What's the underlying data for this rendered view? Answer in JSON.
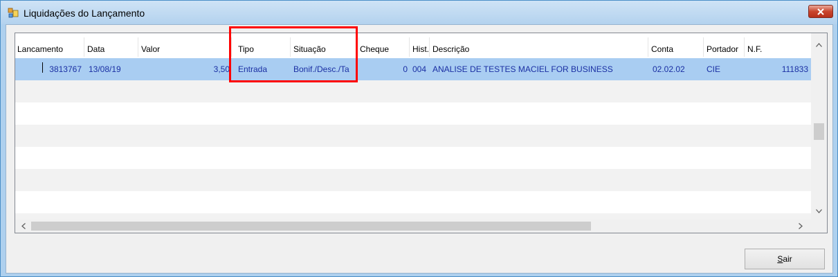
{
  "window": {
    "title": "Liquidações do Lançamento"
  },
  "grid": {
    "columns": [
      "Lancamento",
      "Data",
      "Valor",
      "Tipo",
      "Situação",
      "Cheque",
      "Hist.",
      "Descrição",
      "Conta",
      "Portador",
      "N.F."
    ],
    "rows": [
      {
        "lancamento": "3813767",
        "data": "13/08/19",
        "valor": "3,50",
        "tipo": "Entrada",
        "situacao": "Bonif./Desc./Ta",
        "cheque": "0",
        "hist": "004",
        "descricao": "ANALISE DE TESTES MACIEL FOR BUSINESS",
        "conta": "02.02.02",
        "portador": "CIE",
        "nf": "111833"
      }
    ]
  },
  "buttons": {
    "sair_mnemonic": "S",
    "sair_rest": "air"
  },
  "colors": {
    "selection": "#a9cdf2",
    "cell_text": "#1a2fa3",
    "highlight": "#ff0000",
    "close_button": "#c9452d"
  }
}
